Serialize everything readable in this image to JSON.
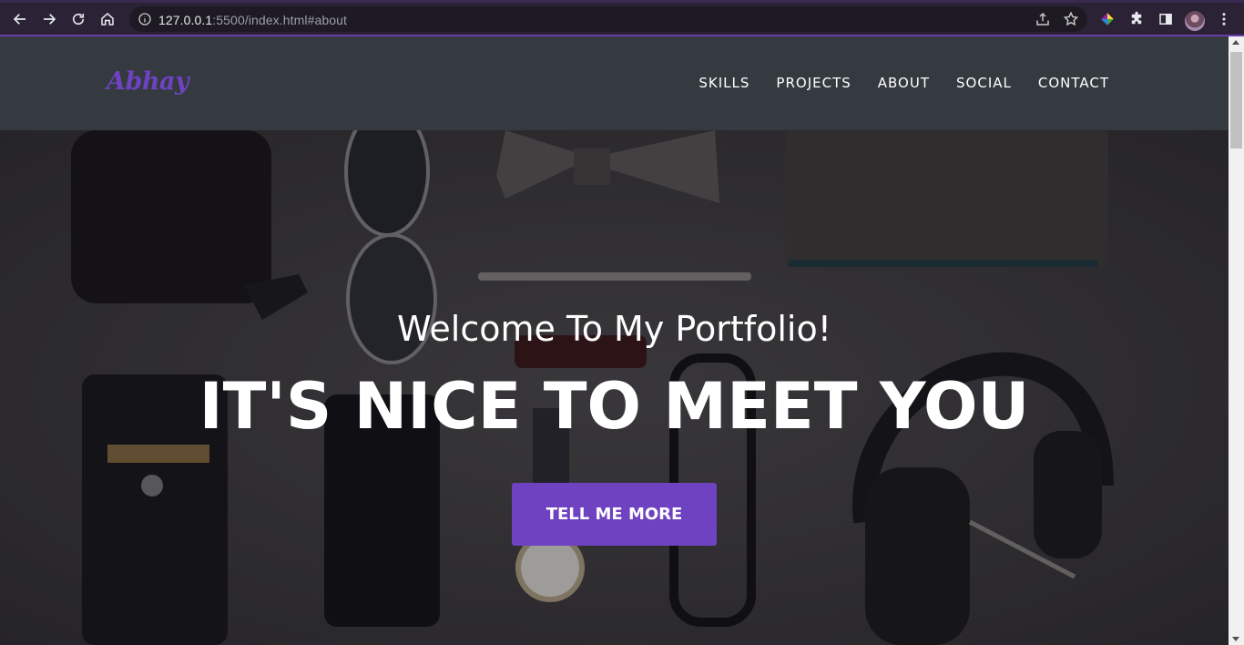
{
  "browser": {
    "url_host": "127.0.0.1",
    "url_rest": ":5500/index.html#about"
  },
  "site": {
    "brand": "Abhay",
    "nav": [
      "SKILLS",
      "PROJECTS",
      "ABOUT",
      "SOCIAL",
      "CONTACT"
    ],
    "brand_color": "#6f42c1",
    "nav_bg": "#343a40"
  },
  "hero": {
    "subtitle": "Welcome To My Portfolio!",
    "title": "IT'S NICE TO MEET YOU",
    "button": "TELL ME MORE",
    "button_color": "#6f42c1"
  },
  "icons": [
    "back-icon",
    "forward-icon",
    "reload-icon",
    "home-icon",
    "info-icon",
    "share-icon",
    "star-icon",
    "color-extension-icon",
    "puzzle-icon",
    "side-panel-icon",
    "menu-icon"
  ]
}
